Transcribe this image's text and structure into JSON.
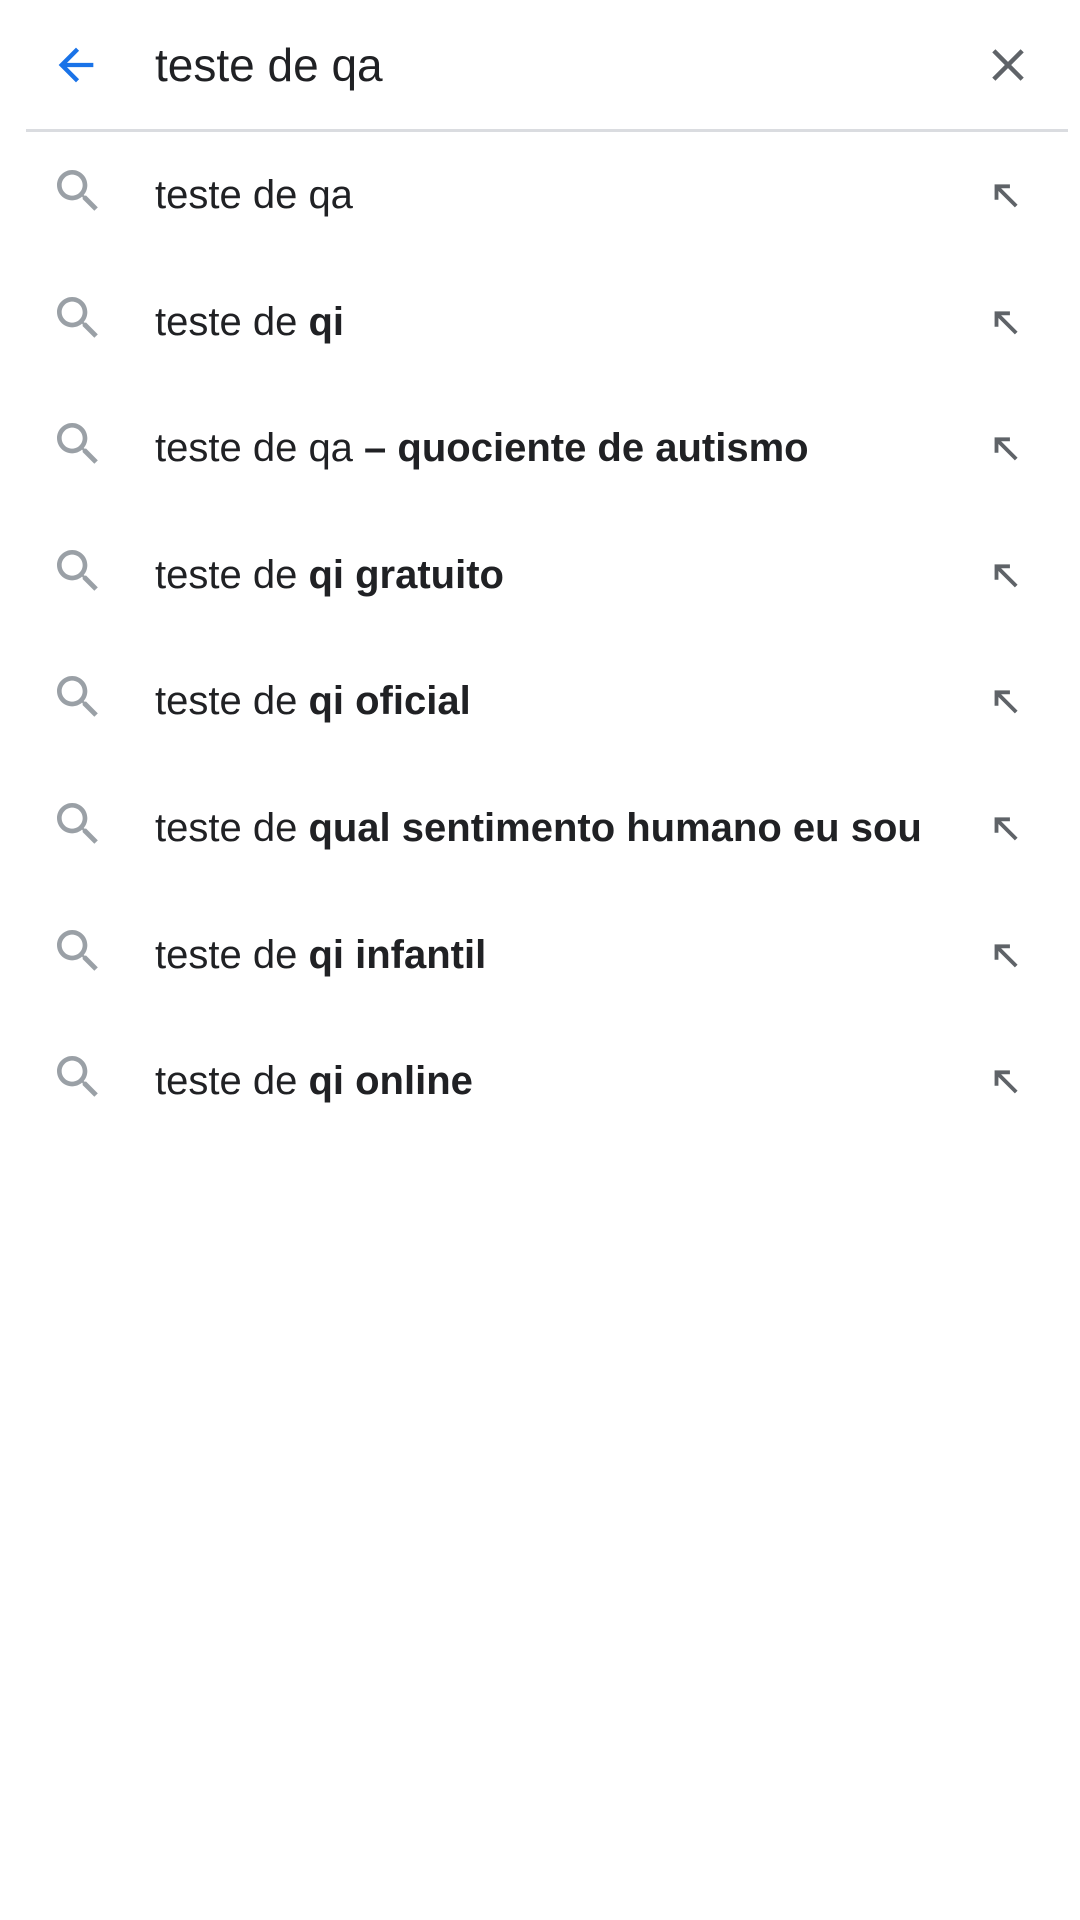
{
  "search": {
    "query": "teste de qa",
    "back_icon": "arrow-left-icon",
    "clear_icon": "close-icon"
  },
  "colors": {
    "accent": "#1a73e8",
    "icon_gray": "#9aa0a6",
    "icon_dark": "#5f6368",
    "text": "#202124",
    "divider": "#dadce0"
  },
  "suggestions": [
    {
      "prefix": "teste de qa",
      "bold": ""
    },
    {
      "prefix": "teste de ",
      "bold": "qi"
    },
    {
      "prefix": "teste de qa ",
      "bold": "– quociente de autismo"
    },
    {
      "prefix": "teste de ",
      "bold": "qi gratuito"
    },
    {
      "prefix": "teste de ",
      "bold": "qi oficial"
    },
    {
      "prefix": "teste de ",
      "bold": "qual sentimento humano eu sou"
    },
    {
      "prefix": "teste de ",
      "bold": "qi infantil"
    },
    {
      "prefix": "teste de ",
      "bold": "qi online"
    }
  ],
  "suggestion_icon": "search-icon",
  "fill_icon": "arrow-up-left-icon"
}
